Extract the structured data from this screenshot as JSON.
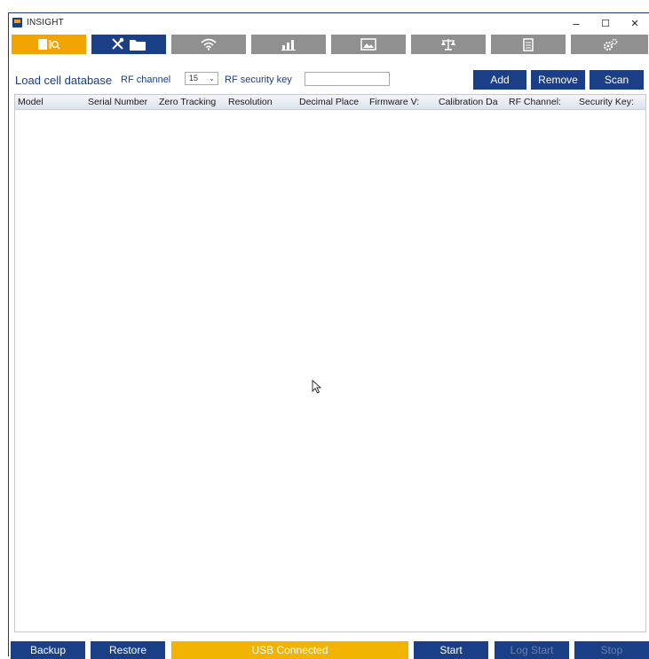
{
  "window": {
    "title": "INSIGHT",
    "controls": [
      "–",
      "☐",
      "✕"
    ]
  },
  "tabs": [
    {
      "icon": "database-search-icon",
      "state": "active-orange"
    },
    {
      "icon": "tools-folder-icon",
      "state": "active-blue"
    },
    {
      "icon": "wifi-icon",
      "state": "inactive"
    },
    {
      "icon": "chart-icon",
      "state": "inactive"
    },
    {
      "icon": "image-icon",
      "state": "inactive"
    },
    {
      "icon": "scale-icon",
      "state": "inactive"
    },
    {
      "icon": "document-icon",
      "state": "inactive"
    },
    {
      "icon": "settings-icon",
      "state": "inactive"
    }
  ],
  "toolbar": {
    "section_label": "Load cell database",
    "rf_channel_label": "RF channel",
    "rf_channel_value": "15",
    "rf_security_label": "RF security key",
    "rf_security_value": "",
    "add_label": "Add",
    "remove_label": "Remove",
    "scan_label": "Scan"
  },
  "table": {
    "columns": [
      "Model",
      "Serial Number",
      "Zero Tracking",
      "Resolution",
      "Decimal Place",
      "Firmware V:",
      "Calibration Da",
      "RF Channel:",
      "Security Key:"
    ],
    "rows": []
  },
  "bottom": {
    "backup_label": "Backup",
    "restore_label": "Restore",
    "status_text": "USB Connected",
    "start_label": "Start",
    "log_start_label": "Log Start",
    "stop_label": "Stop"
  },
  "colors": {
    "accent_blue": "#1b3f86",
    "accent_orange": "#f2a400",
    "inactive_gray": "#909090"
  }
}
